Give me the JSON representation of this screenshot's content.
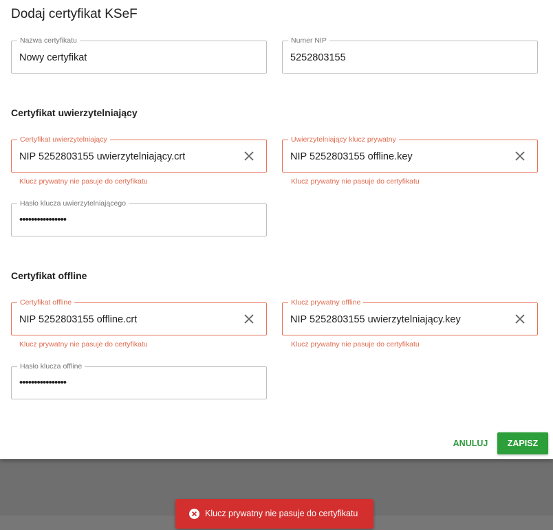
{
  "dialog": {
    "title": "Dodaj certyfikat KSeF",
    "fields": {
      "name": {
        "label": "Nazwa certyfikatu",
        "value": "Nowy certyfikat"
      },
      "nip": {
        "label": "Numer NIP",
        "value": "5252803155"
      }
    },
    "auth_section": {
      "title": "Certyfikat uwierzytelniający",
      "cert": {
        "label": "Certyfikat uwierzytelniający",
        "value": "NIP 5252803155 uwierzytelniający.crt",
        "error": "Klucz prywatny nie pasuje do certyfikatu"
      },
      "key": {
        "label": "Uwierzytelniający klucz prywatny",
        "value": "NIP 5252803155 offline.key",
        "error": "Klucz prywatny nie pasuje do certyfikatu"
      },
      "password": {
        "label": "Hasło klucza uwierzytelniającego",
        "value": "••••••••••••••••"
      }
    },
    "offline_section": {
      "title": "Certyfikat offline",
      "cert": {
        "label": "Certyfikat offline",
        "value": "NIP 5252803155 offline.crt",
        "error": "Klucz prywatny nie pasuje do certyfikatu"
      },
      "key": {
        "label": "Klucz prywatny offline",
        "value": "NIP 5252803155 uwierzytelniający.key",
        "error": "Klucz prywatny nie pasuje do certyfikatu"
      },
      "password": {
        "label": "Hasło klucza offline",
        "value": "••••••••••••••••"
      }
    },
    "actions": {
      "cancel_label": "ANULUJ",
      "save_label": "ZAPISZ"
    }
  },
  "toast": {
    "message": "Klucz prywatny nie pasuje do certyfikatu",
    "icon": "error-circle-icon"
  },
  "colors": {
    "accent": "#2d9f3a",
    "error": "#e06b4f",
    "toast_bg": "#d32f2f"
  }
}
